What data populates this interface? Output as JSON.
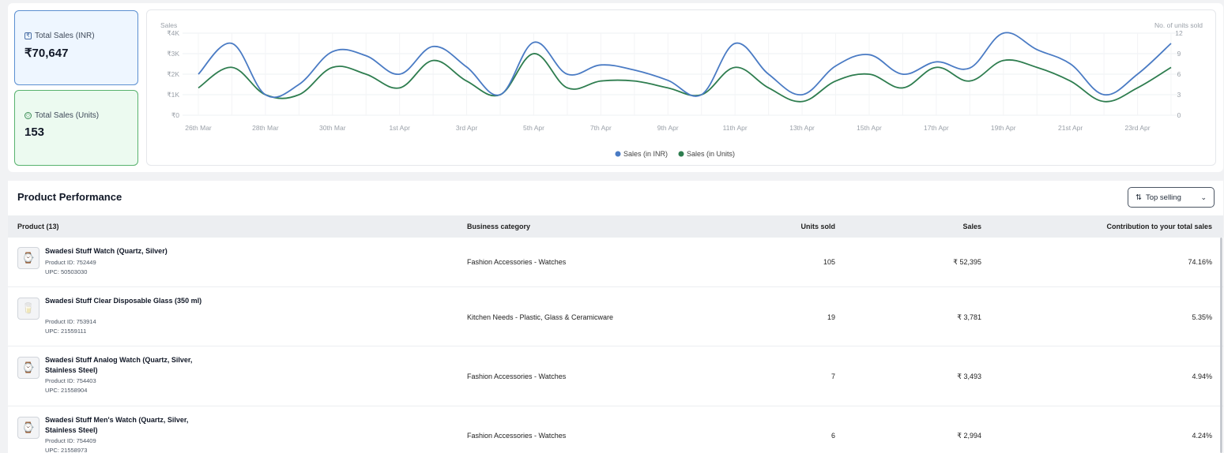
{
  "summary": {
    "inr": {
      "icon": "rupee-icon",
      "label": "Total Sales (INR)",
      "value": "₹70,647"
    },
    "units": {
      "icon": "box-icon",
      "label": "Total Sales (Units)",
      "value": "153"
    }
  },
  "chart_data": {
    "type": "line",
    "ylabel_left": "Sales",
    "ylabel_right": "No. of units sold",
    "left_ticks": [
      "₹0",
      "₹1K",
      "₹2K",
      "₹3K",
      "₹4K"
    ],
    "right_ticks": [
      "0",
      "3",
      "6",
      "9",
      "12"
    ],
    "ylim_left": [
      0,
      4000
    ],
    "ylim_right": [
      0,
      12
    ],
    "x_tick_labels": [
      "26th Mar",
      "28th Mar",
      "30th Mar",
      "1st Apr",
      "3rd Apr",
      "5th Apr",
      "7th Apr",
      "9th Apr",
      "11th Apr",
      "13th Apr",
      "15th Apr",
      "17th Apr",
      "19th Apr",
      "21st Apr",
      "23rd Apr"
    ],
    "x": [
      "26th Mar",
      "27th Mar",
      "28th Mar",
      "29th Mar",
      "30th Mar",
      "31st Mar",
      "1st Apr",
      "2nd Apr",
      "3rd Apr",
      "4th Apr",
      "5th Apr",
      "6th Apr",
      "7th Apr",
      "8th Apr",
      "9th Apr",
      "10th Apr",
      "11th Apr",
      "12th Apr",
      "13th Apr",
      "14th Apr",
      "15th Apr",
      "16th Apr",
      "17th Apr",
      "18th Apr",
      "19th Apr",
      "20th Apr",
      "21st Apr",
      "22nd Apr",
      "23rd Apr",
      "24th Apr"
    ],
    "series": [
      {
        "name": "Sales (in INR)",
        "color": "#4a7bc4",
        "axis": "left",
        "values": [
          2000,
          3500,
          1000,
          1500,
          3100,
          2900,
          2000,
          3350,
          2350,
          1000,
          3550,
          2000,
          2450,
          2200,
          1700,
          1000,
          3500,
          2000,
          1000,
          2400,
          2950,
          2000,
          2600,
          2300,
          4000,
          3200,
          2500,
          1000,
          2000,
          3500
        ]
      },
      {
        "name": "Sales (in Units)",
        "color": "#2e7d4f",
        "axis": "right",
        "values": [
          4,
          7,
          3,
          3,
          7,
          6,
          4,
          8,
          5,
          3,
          9,
          4,
          5,
          5,
          4,
          3,
          7,
          4,
          2,
          5,
          6,
          4,
          7,
          5,
          8,
          7,
          5,
          2,
          4,
          7
        ]
      }
    ],
    "legend_position": "bottom",
    "grid": true
  },
  "performance": {
    "title": "Product Performance",
    "sort_label": "Top selling",
    "columns": {
      "product": "Product (13)",
      "category": "Business category",
      "units": "Units sold",
      "sales": "Sales",
      "contribution": "Contribution to your total sales"
    },
    "rows": [
      {
        "name": "Swadesi Stuff Watch (Quartz, Silver)",
        "pid": "Product ID: 752449",
        "upc": "UPC: 50503030",
        "category": "Fashion Accessories - Watches",
        "units": "105",
        "sales": "₹ 52,395",
        "contribution": "74.16%",
        "icon": "watch-icon",
        "glyph": "⌚"
      },
      {
        "name": "Swadesi Stuff Clear Disposable Glass (350 ml)",
        "pid": "Product ID: 753914",
        "upc": "UPC: 21559111",
        "category": "Kitchen Needs - Plastic, Glass & Ceramicware",
        "units": "19",
        "sales": "₹ 3,781",
        "contribution": "5.35%",
        "icon": "glass-icon",
        "glyph": "🥛"
      },
      {
        "name": "Swadesi Stuff Analog Watch (Quartz, Silver, Stainless Steel)",
        "pid": "Product ID: 754403",
        "upc": "UPC: 21558904",
        "category": "Fashion Accessories - Watches",
        "units": "7",
        "sales": "₹ 3,493",
        "contribution": "4.94%",
        "icon": "watch-icon",
        "glyph": "⌚"
      },
      {
        "name": "Swadesi Stuff Men's Watch (Quartz, Silver, Stainless Steel)",
        "pid": "Product ID: 754409",
        "upc": "UPC: 21558973",
        "category": "Fashion Accessories - Watches",
        "units": "6",
        "sales": "₹ 2,994",
        "contribution": "4.24%",
        "icon": "watch-icon",
        "glyph": "⌚"
      }
    ]
  }
}
